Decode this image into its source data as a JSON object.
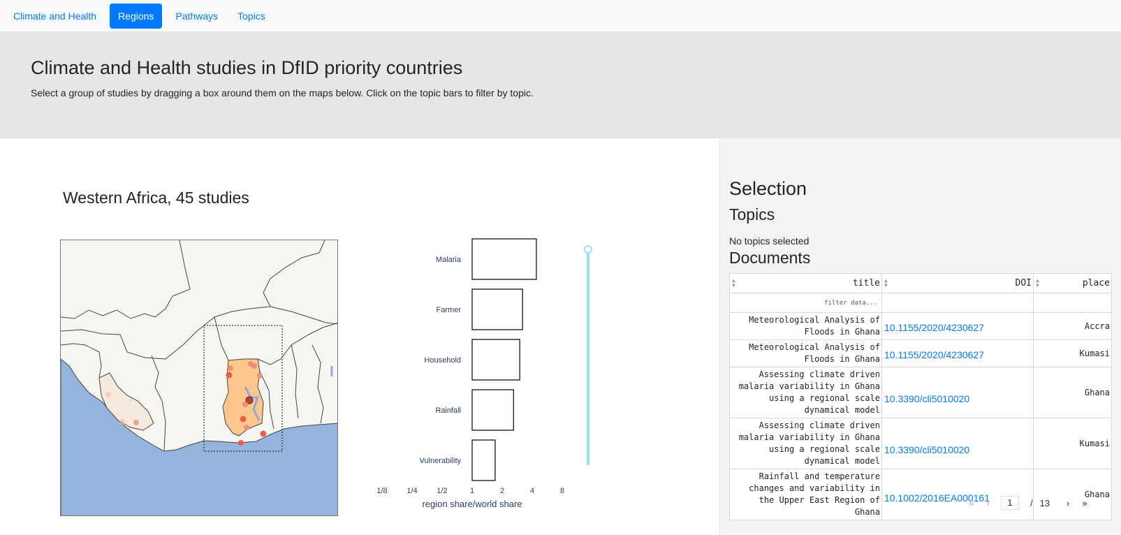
{
  "nav": {
    "items": [
      {
        "label": "Climate and Health",
        "active": false
      },
      {
        "label": "Regions",
        "active": true
      },
      {
        "label": "Pathways",
        "active": false
      },
      {
        "label": "Topics",
        "active": false
      }
    ]
  },
  "hero": {
    "title": "Climate and Health studies in DfID priority countries",
    "subtitle": "Select a group of studies by dragging a box around them on the maps below. Click on the topic bars to filter by topic."
  },
  "region": {
    "title": "Western Africa, 45 studies"
  },
  "chart_data": {
    "type": "bar",
    "orientation": "horizontal",
    "categories": [
      "Malaria",
      "Farmer",
      "Household",
      "Rainfall",
      "Vulnerability"
    ],
    "values": [
      4.4,
      3.2,
      3.0,
      2.6,
      1.7
    ],
    "xscale": "log2",
    "xticks": [
      "1/8",
      "1/4",
      "1/2",
      "1",
      "2",
      "4",
      "8"
    ],
    "xlabel": "region share/world share",
    "bar_fill": "#ffffff",
    "bar_stroke": "#000000",
    "slider_color": "#9edcf7"
  },
  "selection": {
    "title": "Selection",
    "topics_title": "Topics",
    "no_topics": "No topics selected",
    "documents_title": "Documents"
  },
  "table": {
    "columns": [
      "title",
      "DOI",
      "place"
    ],
    "filter_placeholder": "filter data...",
    "rows": [
      {
        "title": "Meteorological Analysis of Floods in Ghana",
        "doi": "10.1155/2020/4230627",
        "place": "Accra"
      },
      {
        "title": "Meteorological Analysis of Floods in Ghana",
        "doi": "10.1155/2020/4230627",
        "place": "Kumasi"
      },
      {
        "title": "Assessing climate driven malaria variability in Ghana using a regional scale dynamical model",
        "doi": "10.3390/cli5010020",
        "place": "Ghana"
      },
      {
        "title": "Assessing climate driven malaria variability in Ghana using a regional scale dynamical model",
        "doi": "10.3390/cli5010020",
        "place": "Kumasi"
      },
      {
        "title": "Rainfall and temperature changes and variability in the Upper East Region of Ghana",
        "doi": "10.1002/2016EA000161",
        "place": "Ghana"
      }
    ]
  },
  "pager": {
    "current": "1",
    "sep": "/",
    "total": "13"
  },
  "colors": {
    "accent": "#007bff",
    "hero_bg": "#e6e6e6",
    "ocean": "#94b4dc",
    "land": "#f7f5ef",
    "highlight": "#fdc68c",
    "point": "#e9604a"
  }
}
